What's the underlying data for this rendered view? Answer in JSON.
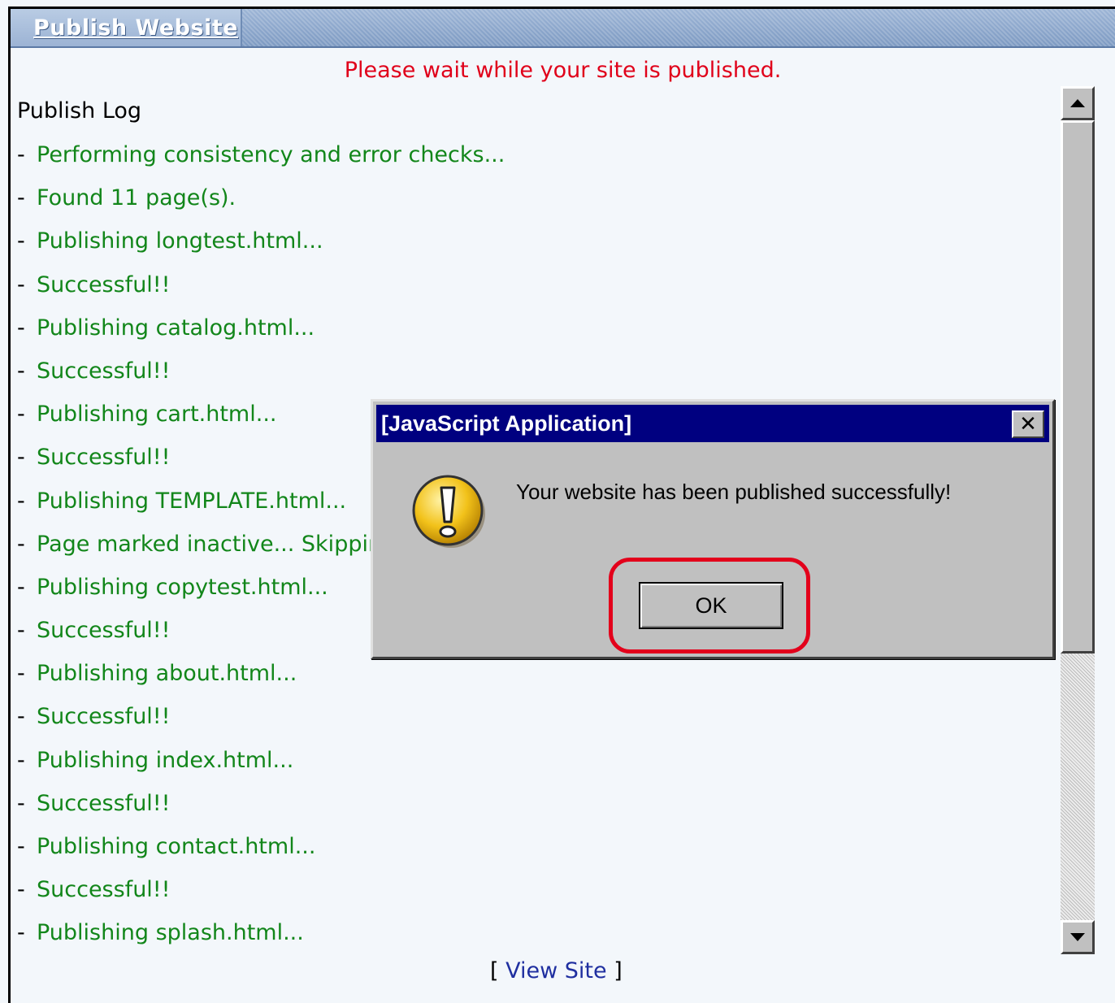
{
  "header": {
    "title": "Publish Website"
  },
  "status": {
    "message": "Please wait while your site is published."
  },
  "log": {
    "heading": "Publish Log",
    "bullet": "-",
    "entries": [
      "Performing consistency and error checks...",
      "Found 11 page(s).",
      "Publishing longtest.html...",
      "Successful!!",
      "Publishing catalog.html...",
      "Successful!!",
      "Publishing cart.html...",
      "Successful!!",
      "Publishing TEMPLATE.html...",
      "Page marked inactive... Skipping",
      "Publishing copytest.html...",
      "Successful!!",
      "Publishing about.html...",
      "Successful!!",
      "Publishing index.html...",
      "Successful!!",
      "Publishing contact.html...",
      "Successful!!",
      "Publishing splash.html..."
    ]
  },
  "footer": {
    "open_bracket": "[",
    "link_label": "View Site",
    "close_bracket": "]"
  },
  "dialog": {
    "title": "[JavaScript Application]",
    "close_glyph": "✕",
    "message": "Your website has been published successfully!",
    "ok_label": "OK",
    "icon": "warning-exclamation-icon"
  },
  "colors": {
    "status_red": "#e0001a",
    "log_green": "#12861a",
    "dialog_title_bg": "#000080",
    "highlight_red": "#e3001b",
    "link_blue": "#1f2fa0"
  }
}
